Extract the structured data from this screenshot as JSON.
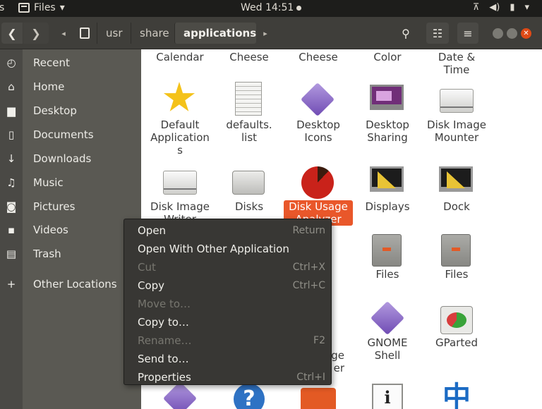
{
  "topbar": {
    "activities_fragment": "s",
    "app_menu_label": "Files",
    "app_menu_arrow": "▾",
    "clock": "Wed 14:51",
    "tray_icons": [
      "network-icon",
      "volume-icon",
      "battery-icon",
      "chevron-down-icon"
    ]
  },
  "header": {
    "back_glyph": "❮",
    "forward_glyph": "❯",
    "path_left_glyph": "◂",
    "path_right_glyph": "▸",
    "path": [
      "usr",
      "share",
      "applications"
    ],
    "search_glyph": "⚲",
    "view_glyph": "☷",
    "menu_glyph": "≡",
    "close_glyph": "✕"
  },
  "sidebar": {
    "items": [
      {
        "label": "Recent",
        "icon": "clock-icon",
        "glyph": "◴"
      },
      {
        "label": "Home",
        "icon": "home-icon",
        "glyph": "⌂"
      },
      {
        "label": "Desktop",
        "icon": "folder-icon",
        "glyph": "▆"
      },
      {
        "label": "Documents",
        "icon": "document-icon",
        "glyph": "▯"
      },
      {
        "label": "Downloads",
        "icon": "download-icon",
        "glyph": "↓"
      },
      {
        "label": "Music",
        "icon": "music-icon",
        "glyph": "♫"
      },
      {
        "label": "Pictures",
        "icon": "camera-icon",
        "glyph": "◙"
      },
      {
        "label": "Videos",
        "icon": "video-icon",
        "glyph": "▪"
      },
      {
        "label": "Trash",
        "icon": "trash-icon",
        "glyph": "▤"
      },
      {
        "label": "Other Locations",
        "icon": "plus-icon",
        "glyph": "+"
      }
    ]
  },
  "files": {
    "row0": [
      "Calendar",
      "Cheese",
      "Cheese",
      "Color",
      "Date &\nTime"
    ],
    "row1": [
      "Default\nApplication\ns",
      "defaults.\nlist",
      "Desktop\nIcons",
      "Desktop\nSharing",
      "Disk Image\nMounter"
    ],
    "row2": [
      "Disk Image\nWriter",
      "Disks",
      "Disk Usage\nAnalyzer",
      "Displays",
      "Dock"
    ],
    "row3": [
      "Files",
      "Files"
    ],
    "row4": [
      "GNOME\nShell",
      "GParted"
    ],
    "partial_labels": [
      "ge",
      "er"
    ],
    "help_glyph": "?",
    "info_glyph": "i",
    "han_glyph": "中"
  },
  "context_menu": {
    "items": [
      {
        "label": "Open",
        "accel": "Return",
        "disabled": false
      },
      {
        "label": "Open With Other Application",
        "accel": "",
        "disabled": false
      },
      {
        "label": "Cut",
        "accel": "Ctrl+X",
        "disabled": true
      },
      {
        "label": "Copy",
        "accel": "Ctrl+C",
        "disabled": false
      },
      {
        "label": "Move to…",
        "accel": "",
        "disabled": true
      },
      {
        "label": "Copy to…",
        "accel": "",
        "disabled": false
      },
      {
        "label": "Rename…",
        "accel": "F2",
        "disabled": true
      },
      {
        "label": "Send to…",
        "accel": "",
        "disabled": false
      },
      {
        "label": "Properties",
        "accel": "Ctrl+I",
        "disabled": false
      }
    ]
  }
}
